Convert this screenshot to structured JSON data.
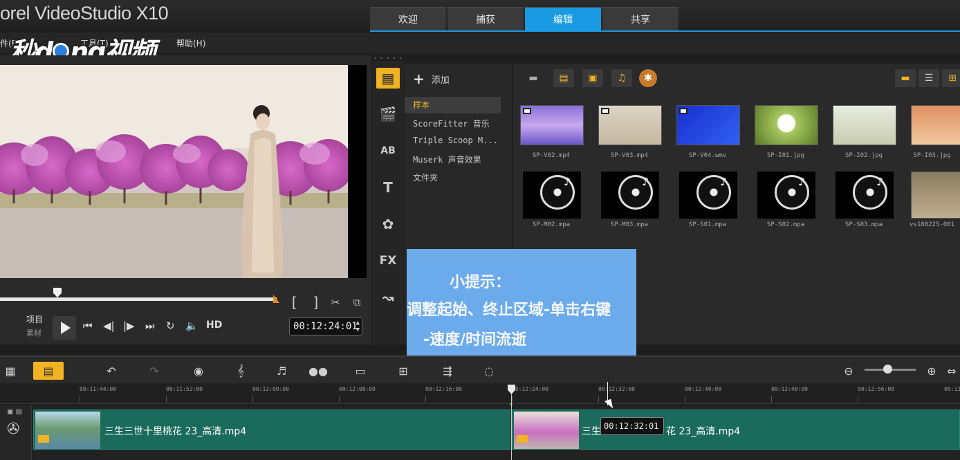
{
  "app": {
    "title": "orel VideoStudio X10"
  },
  "tabs": [
    {
      "label": "欢迎",
      "active": false
    },
    {
      "label": "捕获",
      "active": false
    },
    {
      "label": "编辑",
      "active": true
    },
    {
      "label": "共享",
      "active": false
    }
  ],
  "menu": {
    "file": "件(F)",
    "tools": "工具(T)",
    "help": "帮助(H)"
  },
  "watermark": {
    "pre": "秒d",
    "post": "ng视频"
  },
  "preview": {
    "mode_project": "项目",
    "mode_clip": "素材",
    "hd_label": "HD",
    "timecode": "00:12:24:01",
    "scrub_position": 0.16
  },
  "library": {
    "add_label": "添加",
    "nav_items": [
      {
        "label": "样本",
        "selected": true
      },
      {
        "label": "ScoreFitter 音乐",
        "selected": false
      },
      {
        "label": "Triple Scoop M...",
        "selected": false
      },
      {
        "label": "Muserk 声音效果",
        "selected": false
      },
      {
        "label": "文件夹",
        "selected": false
      }
    ],
    "thumbnails": [
      {
        "name": "SP-V02.mp4",
        "kind": "video-purple"
      },
      {
        "name": "SP-V03.mp4",
        "kind": "video-beige"
      },
      {
        "name": "SP-V04.wmv",
        "kind": "video-blue"
      },
      {
        "name": "SP-I01.jpg",
        "kind": "image-dandelion"
      },
      {
        "name": "SP-I02.jpg",
        "kind": "image-tree"
      },
      {
        "name": "SP-I03.jpg",
        "kind": "image-desert"
      },
      {
        "name": "SP-M02.mpa",
        "kind": "audio"
      },
      {
        "name": "SP-M03.mpa",
        "kind": "audio"
      },
      {
        "name": "SP-S01.mpa",
        "kind": "audio"
      },
      {
        "name": "SP-S02.mpa",
        "kind": "audio"
      },
      {
        "name": "SP-S03.mpa",
        "kind": "audio"
      },
      {
        "name": "vs180225-001",
        "kind": "video-person"
      }
    ]
  },
  "tip": {
    "title": "小提示：",
    "line1": "调整起始、终止区域-单击右键",
    "line2": "-速度/时间流逝"
  },
  "timeline": {
    "ruler_labels": [
      "00:11:44:00",
      "00:11:52:00",
      "00:12:00:00",
      "00:12:08:00",
      "00:12:16:00",
      "00:12:24:00",
      "00:12:32:00",
      "00:12:40:00",
      "00:12:48:00",
      "00:12:56:00",
      "00:13"
    ],
    "clip1_label": "三生三世十里桃花 23_高清.mp4",
    "clip2_label_a": "三生",
    "clip2_label_b": "花 23_高清.mp4",
    "tooltip": "00:12:32:01"
  },
  "icons": {
    "sidebar": [
      "media-icon",
      "instant-project-icon",
      "transition-icon",
      "title-icon",
      "graphic-icon",
      "filter-icon",
      "path-icon"
    ],
    "toolbar": [
      "undo-icon",
      "redo-icon",
      "record-icon",
      "sound-mixer-icon",
      "auto-music-icon",
      "motion-tracking-icon",
      "subtitle-icon",
      "multi-camera-icon",
      "time-remap-icon",
      "mask-icon"
    ]
  },
  "colors": {
    "accent": "#1a9ae0",
    "highlight": "#f2b323",
    "clip": "#1b6b5c",
    "tip_bg": "#6fb0f2"
  }
}
